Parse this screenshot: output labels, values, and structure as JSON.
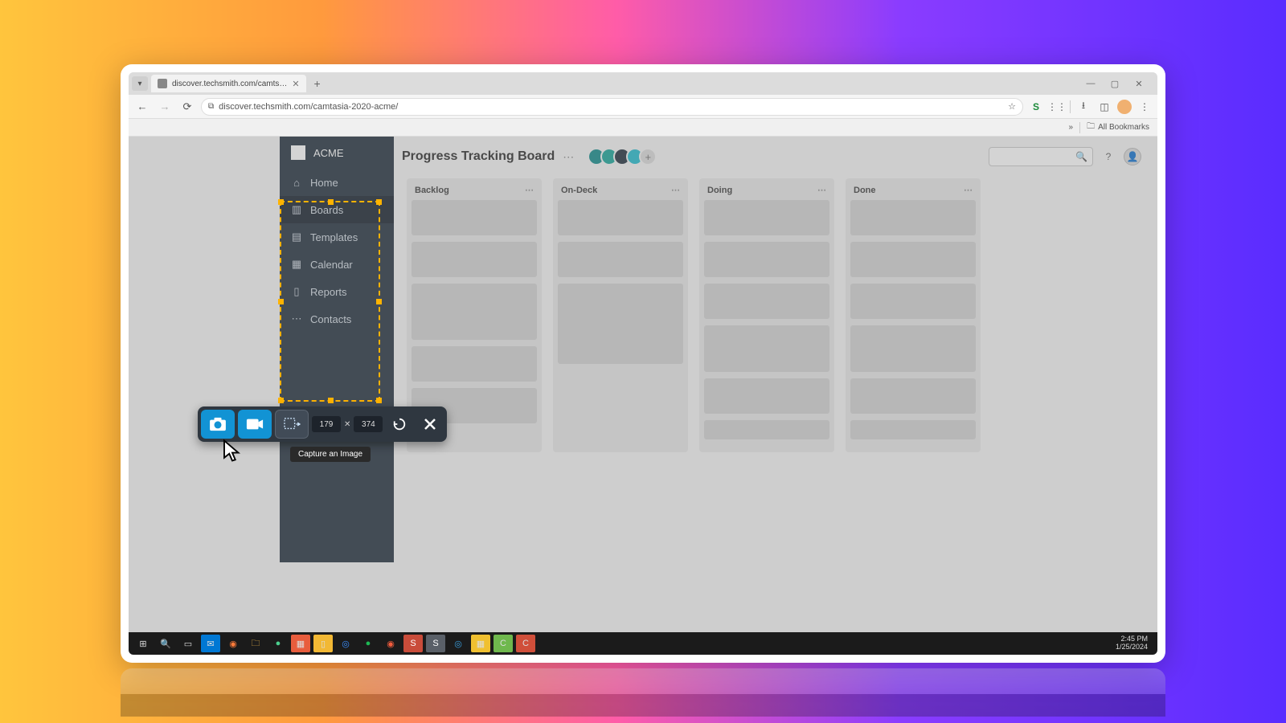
{
  "browser": {
    "tab_title": "discover.techsmith.com/camts…",
    "url": "discover.techsmith.com/camtasia-2020-acme/",
    "bookmarks_label": "All Bookmarks"
  },
  "sidebar": {
    "brand": "ACME",
    "items": [
      "Home",
      "Boards",
      "Templates",
      "Calendar",
      "Reports",
      "Contacts"
    ]
  },
  "page_title": "Progress Tracking Board",
  "board": {
    "columns": [
      {
        "name": "Backlog",
        "cards": 5
      },
      {
        "name": "On-Deck",
        "cards": 3
      },
      {
        "name": "Doing",
        "cards": 6
      },
      {
        "name": "Done",
        "cards": 6
      }
    ]
  },
  "snagit": {
    "width": "179",
    "height": "374",
    "tooltip": "Capture an Image"
  },
  "clock": {
    "time": "2:45 PM",
    "date": "1/25/2024"
  }
}
